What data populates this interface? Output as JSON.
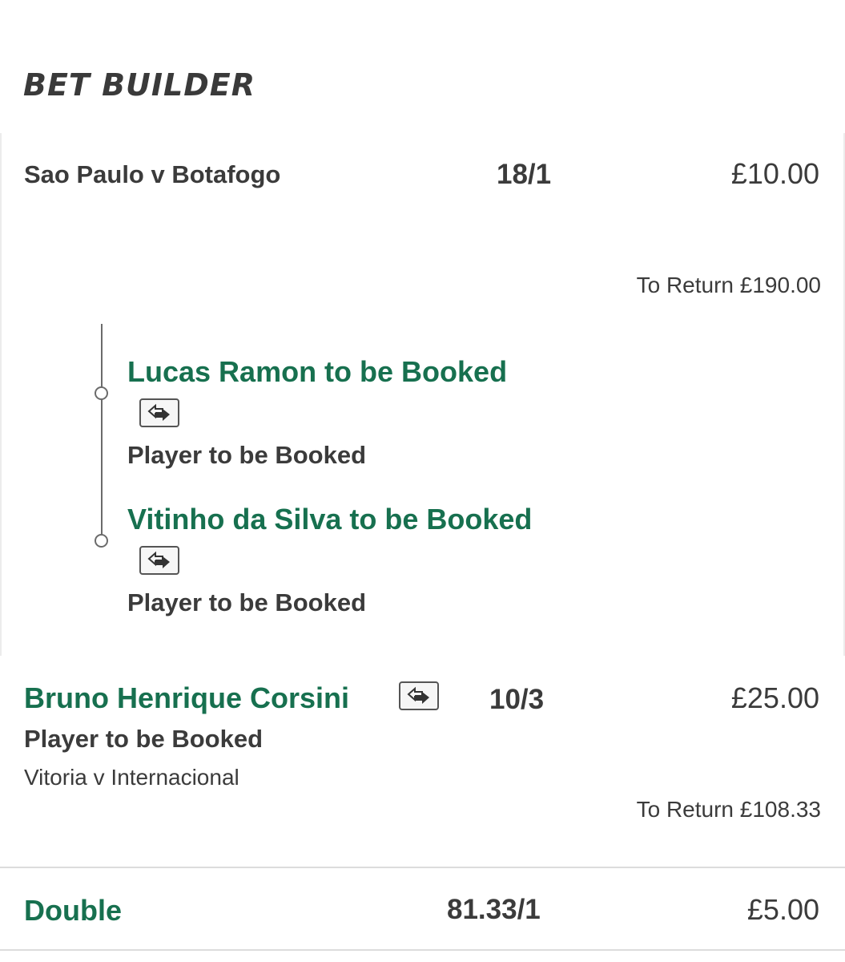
{
  "header": {
    "title": "BET BUILDER"
  },
  "bet_builder": {
    "event": "Sao Paulo v Botafogo",
    "odds": "18/1",
    "stake": "£10.00",
    "to_return": "To Return £190.00",
    "legs": [
      {
        "selection": "Lucas Ramon to be Booked",
        "market": "Player to be Booked",
        "icon": "swap-arrows-icon"
      },
      {
        "selection": "Vitinho da Silva to be Booked",
        "market": "Player to be Booked",
        "icon": "swap-arrows-icon"
      }
    ]
  },
  "single": {
    "selection": "Bruno Henrique Corsini",
    "icon": "swap-arrows-icon",
    "odds": "10/3",
    "stake": "£25.00",
    "market": "Player to be Booked",
    "event": "Vitoria v Internacional",
    "to_return": "To Return £108.33"
  },
  "double": {
    "label": "Double",
    "odds": "81.33/1",
    "stake": "£5.00"
  },
  "colors": {
    "accent_green": "#17704f",
    "text_dark": "#3b3b3b",
    "border": "#dcdcdc"
  }
}
